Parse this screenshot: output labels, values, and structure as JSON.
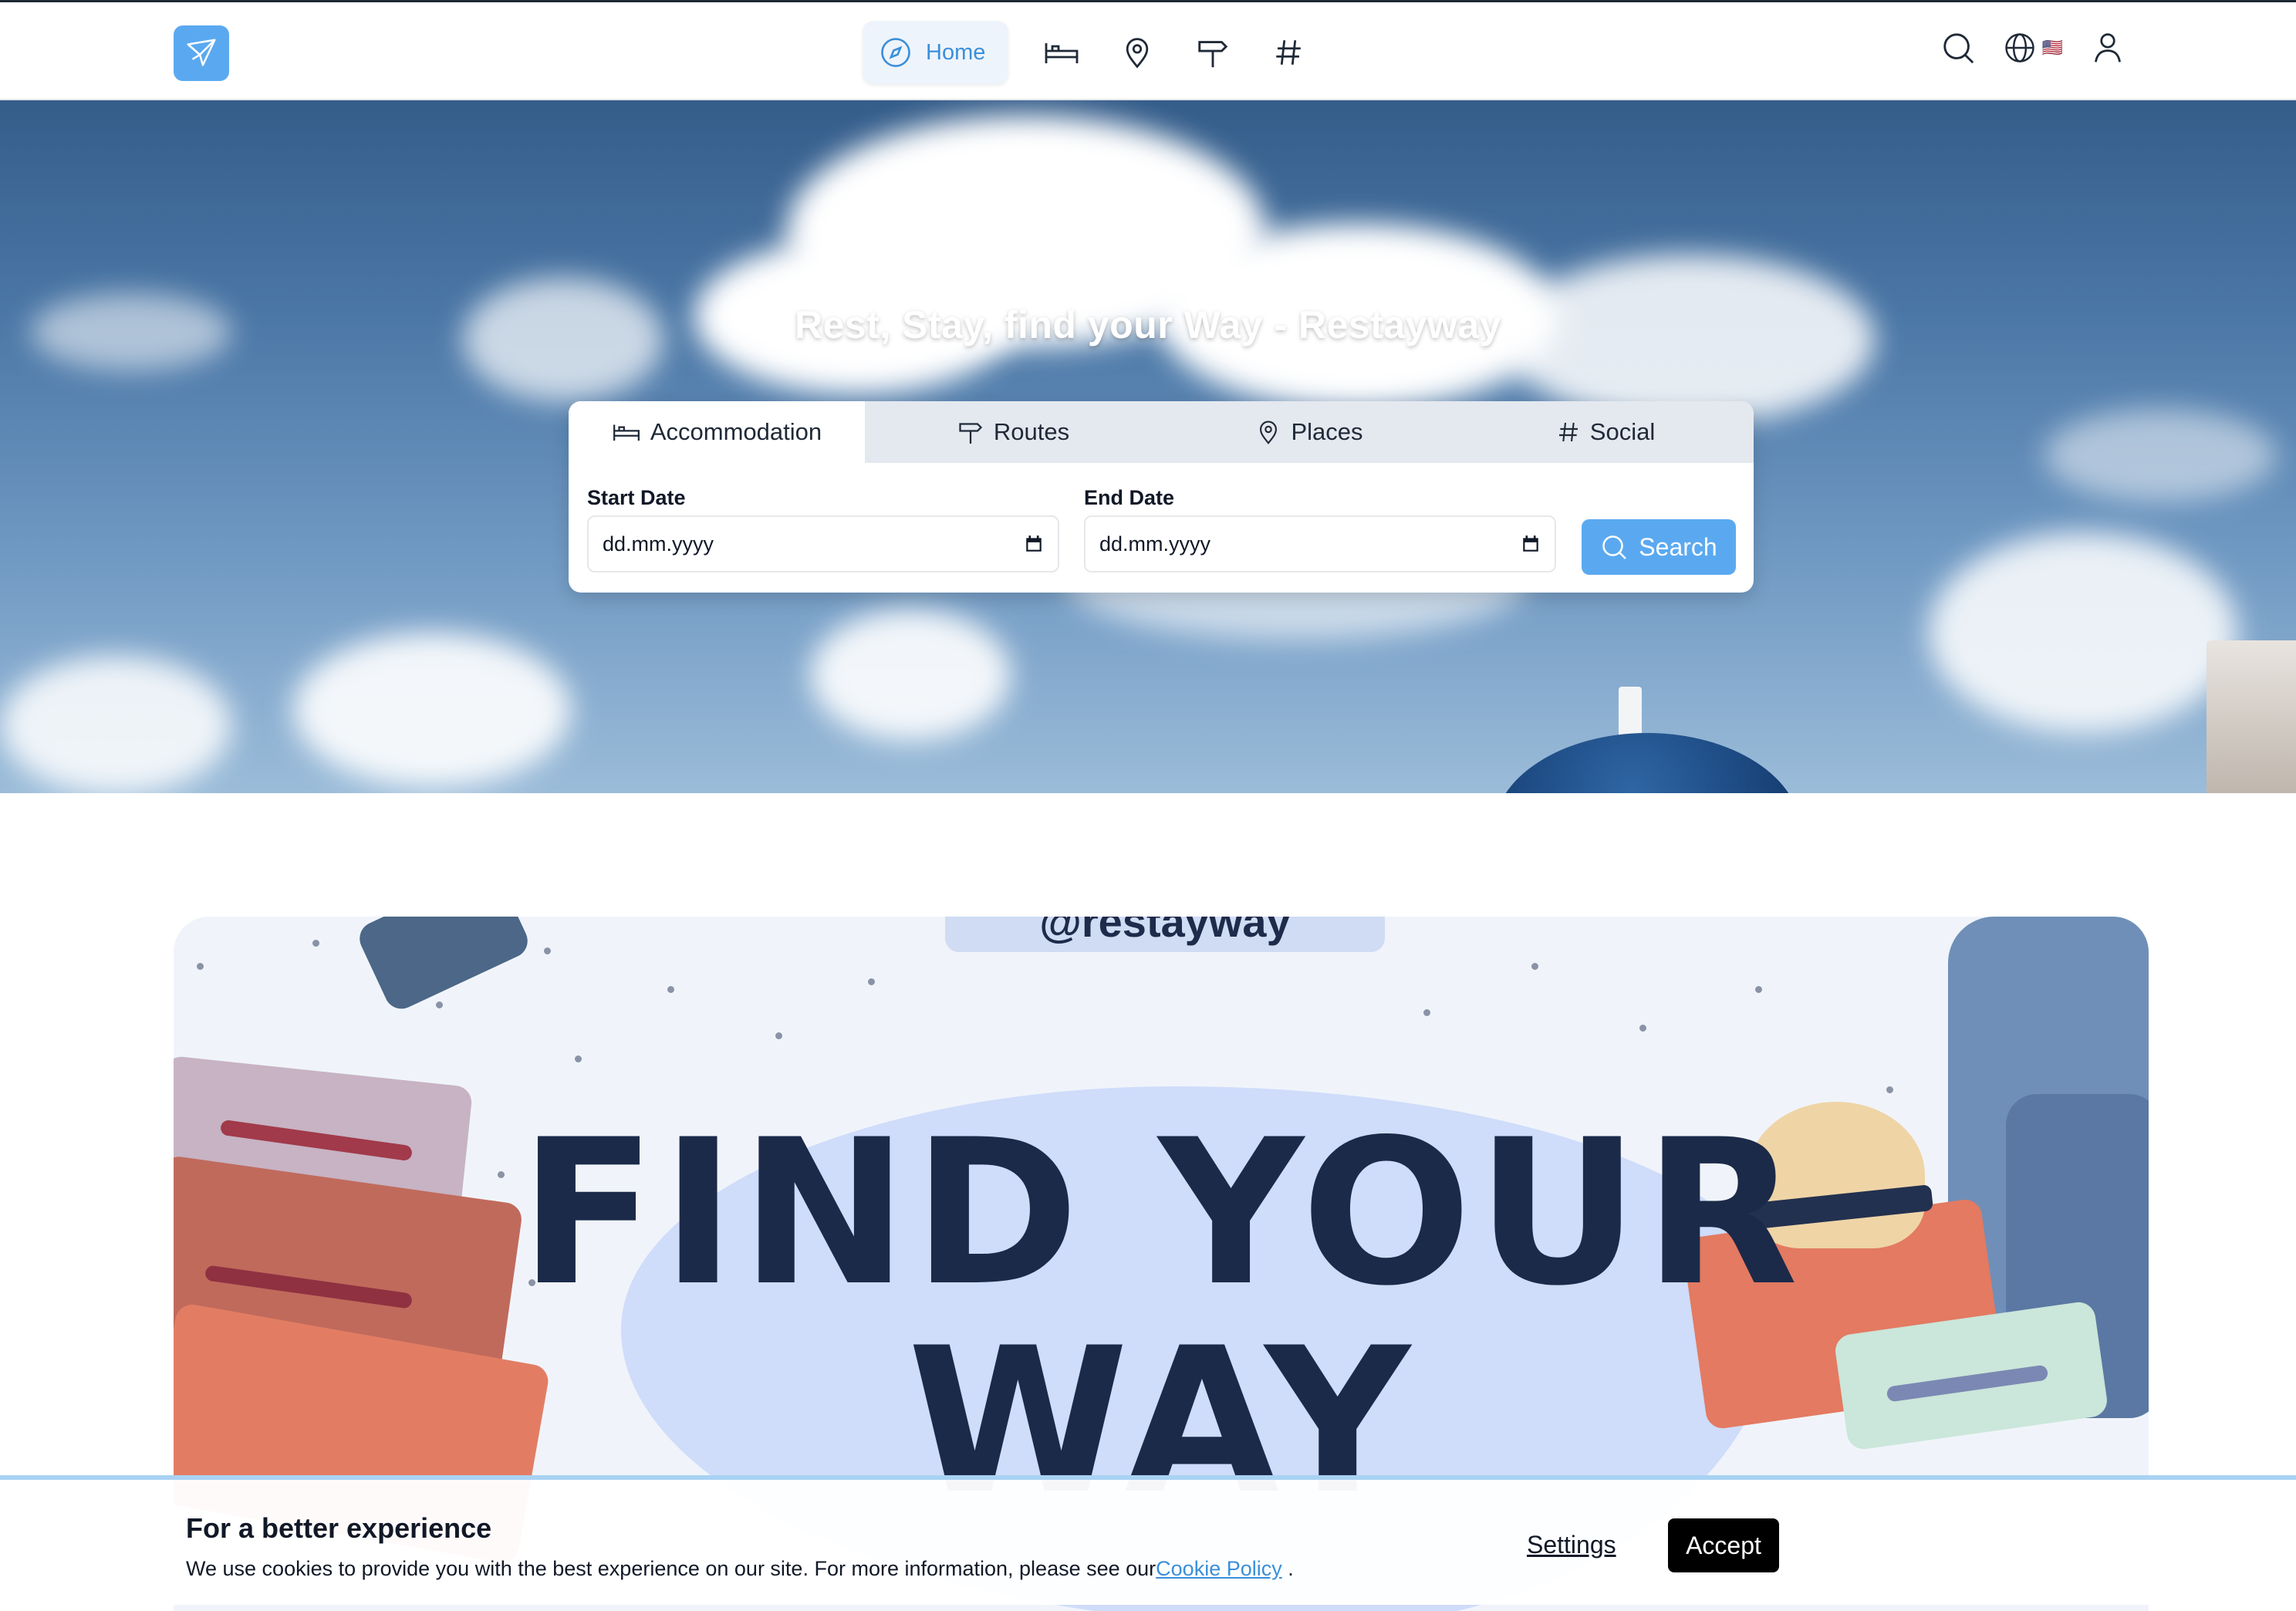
{
  "nav": {
    "logo_icon": "paper-plane-bird-icon",
    "home_label": "Home",
    "items": [
      {
        "icon": "bed-icon"
      },
      {
        "icon": "map-pin-icon"
      },
      {
        "icon": "signpost-icon"
      },
      {
        "icon": "hashtag-icon"
      }
    ],
    "right": [
      {
        "icon": "search-icon"
      },
      {
        "icon": "globe-icon",
        "flag": "🇺🇸"
      },
      {
        "icon": "user-icon"
      }
    ],
    "accent": "#3b8fd9"
  },
  "hero": {
    "title": "Rest, Stay, find your Way - Restayway"
  },
  "search": {
    "tabs": [
      {
        "label": "Accommodation",
        "icon": "bed-icon"
      },
      {
        "label": "Routes",
        "icon": "signpost-icon"
      },
      {
        "label": "Places",
        "icon": "map-pin-icon"
      },
      {
        "label": "Social",
        "icon": "hashtag-icon"
      }
    ],
    "active_tab": "Accommodation",
    "start_label": "Start Date",
    "end_label": "End Date",
    "start_placeholder": "dd.mm.yyyy",
    "end_placeholder": "dd.mm.yyyy",
    "button_label": "Search",
    "button_color": "#5aa9f0"
  },
  "banner": {
    "handle": "@restayway",
    "headline_line1": "FIND YOUR",
    "headline_line2": "WAY"
  },
  "cookie": {
    "title": "For a better experience",
    "text": "We use cookies to provide you with the best experience on our site. For more information, please see our",
    "link": "Cookie Policy",
    "suffix": " .",
    "settings": "Settings",
    "accept": "Accept"
  }
}
